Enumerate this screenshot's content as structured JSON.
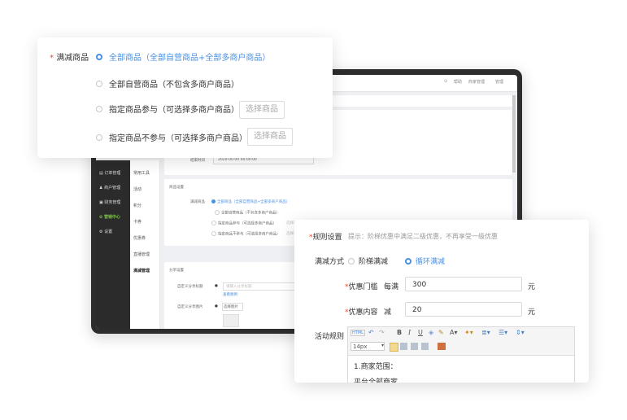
{
  "bg": {
    "topbar": {
      "help": "帮助",
      "merchant": "商家管理",
      "user": "管理"
    },
    "sidebar": [
      {
        "label": "订单管理",
        "active": false
      },
      {
        "label": "商户管理",
        "active": false
      },
      {
        "label": "财务管理",
        "active": false
      },
      {
        "label": "营销中心",
        "active": true
      },
      {
        "label": "设置",
        "active": false
      }
    ],
    "submenu": [
      {
        "label": "常用工具",
        "active": false
      },
      {
        "label": "活动",
        "active": false
      },
      {
        "label": "积分",
        "active": false
      },
      {
        "label": "卡券",
        "active": false
      },
      {
        "label": "优惠券",
        "active": false
      },
      {
        "label": "直播管理",
        "active": false
      },
      {
        "label": "满减管理",
        "active": true
      }
    ],
    "end_time_label": "结束时间",
    "end_time_value": "2020-00-00 00:00:00",
    "goods_section": "商品设置",
    "goods_label": "满减商品",
    "goods_opts": [
      "全部商品（全部自营商品+全部多商户商品）",
      "全部自营商品（不包含多商户商品）",
      "指定商品参与（可选择多商户商品）",
      "指定商品不参与（可选择多商户商品）"
    ],
    "goods_btn": "选择商品",
    "share_section": "分享设置",
    "share_title_label": "自定义分享标题",
    "share_title_placeholder": "请输入分享标题",
    "share_title_link": "查看图例",
    "share_img_label": "自定义分享图片",
    "share_img_btn": "选择图片"
  },
  "popup1": {
    "label": "满减商品",
    "options": [
      {
        "text": "全部商品（全部自营商品+全部多商户商品）",
        "selected": true
      },
      {
        "text": "全部自营商品（不包含多商户商品）",
        "selected": false
      },
      {
        "text": "指定商品参与（可选择多商户商品）",
        "selected": false
      },
      {
        "text": "指定商品不参与（可选择多商户商品）",
        "selected": false
      }
    ],
    "choose_btn": "选择商品"
  },
  "popup2": {
    "title": "规则设置",
    "hint": "提示：阶梯优惠中满足二级优惠，不再享受一级优惠",
    "mode_label": "满减方式",
    "mode_options": [
      {
        "text": "阶梯满减",
        "selected": false
      },
      {
        "text": "循环满减",
        "selected": true
      }
    ],
    "threshold_label": "优惠门槛",
    "threshold_prefix": "每满",
    "threshold_value": "300",
    "threshold_unit": "元",
    "content_label": "优惠内容",
    "content_prefix": "减",
    "content_value": "20",
    "content_unit": "元",
    "rules_label": "活动规则",
    "editor": {
      "html_label": "HTML",
      "font_size": "14px",
      "lines": [
        "1.商家范围：",
        "平台全部商家"
      ]
    }
  },
  "colors": {
    "accent": "#4a90e2",
    "required": "#e94b35",
    "sidebar_active": "#7ac143"
  }
}
